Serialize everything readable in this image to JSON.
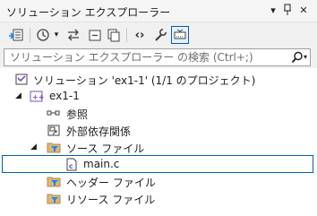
{
  "window": {
    "title": "ソリューション エクスプローラー",
    "dropdown_glyph": "▾",
    "pin_glyph": "ꟷ",
    "close_glyph": "✕"
  },
  "toolbar": {
    "history_dropdown_glyph": "▾",
    "code_glyph": "‹›"
  },
  "search": {
    "placeholder": "ソリューション エクスプローラー の検索 (Ctrl+;)",
    "dropdown_glyph": "▾"
  },
  "tree": {
    "solution": {
      "label": "ソリューション 'ex1-1' (1/1 のプロジェクト)"
    },
    "project": {
      "label": "ex1-1",
      "expanded": true
    },
    "items": [
      {
        "label": "参照"
      },
      {
        "label": "外部依存関係"
      },
      {
        "label": "ソース ファイル",
        "expanded": true
      },
      {
        "label": "main.c",
        "selected": true
      },
      {
        "label": "ヘッダー ファイル"
      },
      {
        "label": "リソース ファイル"
      }
    ]
  },
  "colors": {
    "selection_border": "#005fb8",
    "folder_yellow": "#dcb67a",
    "filter_blue": "#1e88e5",
    "project_purple": "#7b4fb8"
  }
}
